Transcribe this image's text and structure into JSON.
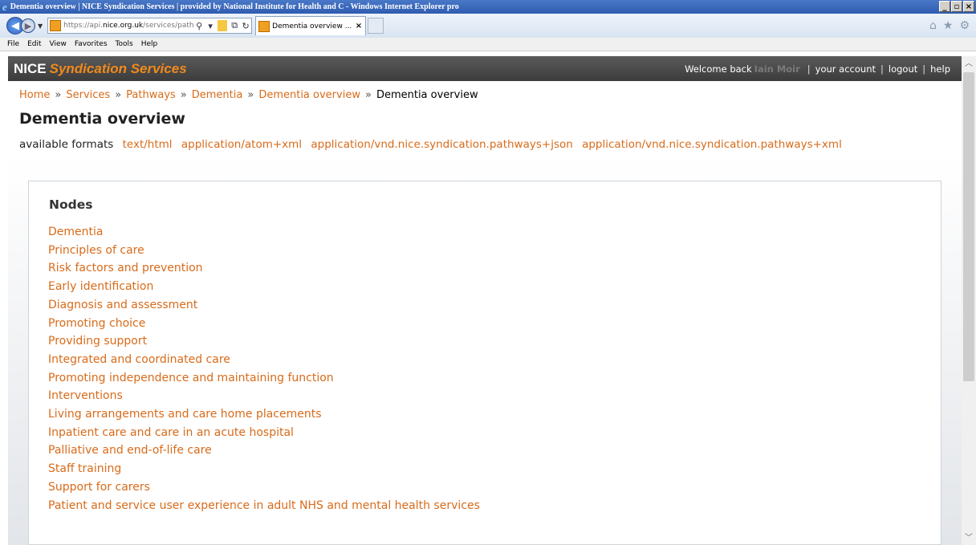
{
  "browser": {
    "window_title": "Dementia overview | NICE Syndication Services | provided by National Institute for Health and C - Windows Internet Explorer pro",
    "address": {
      "prefix": "https://api.",
      "domain": "nice.org.uk",
      "path": "/services/pathways/dementia/deme"
    },
    "tab_title": "Dementia overview ...",
    "tab_close": "×",
    "window_buttons": [
      "_",
      "▫",
      "×"
    ],
    "nav_icons": [
      "home-icon",
      "star-icon",
      "gear-icon"
    ],
    "menu": [
      "File",
      "Edit",
      "View",
      "Favorites",
      "Tools",
      "Help"
    ],
    "accent_color": "#3a6bc2"
  },
  "site": {
    "brand_main": "NICE",
    "brand_sub": "Syndication Services",
    "welcome_text": "Welcome back",
    "user_name": "Iain Moir",
    "links": [
      "your account",
      "logout",
      "help"
    ],
    "brand_color": "#f08a1c"
  },
  "breadcrumb": {
    "items": [
      "Home",
      "Services",
      "Pathways",
      "Dementia",
      "Dementia overview"
    ],
    "current": "Dementia overview",
    "separator": "»"
  },
  "page": {
    "title": "Dementia overview",
    "formats_label": "available formats",
    "formats": [
      "text/html",
      "application/atom+xml",
      "application/vnd.nice.syndication.pathways+json",
      "application/vnd.nice.syndication.pathways+xml"
    ]
  },
  "nodes": {
    "heading": "Nodes",
    "items": [
      "Dementia",
      "Principles of care",
      "Risk factors and prevention",
      "Early identification",
      "Diagnosis and assessment",
      "Promoting choice",
      "Providing support",
      "Integrated and coordinated care",
      "Promoting independence and maintaining function",
      "Interventions",
      "Living arrangements and care home placements",
      "Inpatient care and care in an acute hospital",
      "Palliative and end-of-life care",
      "Staff training",
      "Support for carers",
      "Patient and service user experience in adult NHS and mental health services"
    ],
    "link_color": "#d86b1a"
  }
}
